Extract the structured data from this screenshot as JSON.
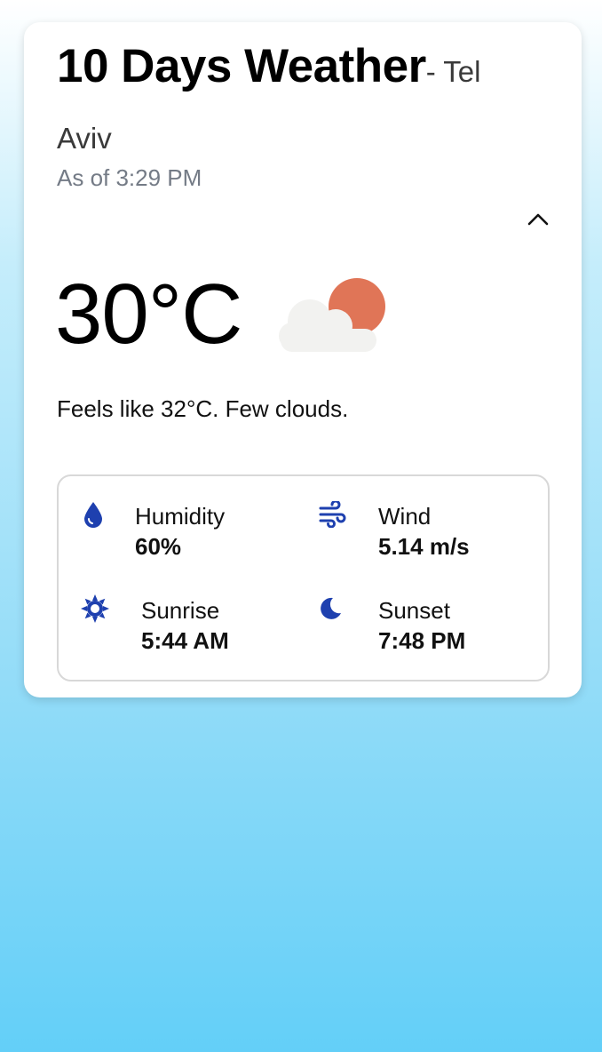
{
  "header": {
    "title": "10 Days Weather",
    "city": "- Tel Aviv",
    "as_of": "As of 3:29 PM"
  },
  "current": {
    "temperature": "30°C",
    "condition_icon": "few-clouds-icon",
    "description": "Feels like 32°C. Few clouds."
  },
  "details": {
    "humidity": {
      "label": "Humidity",
      "value": "60%",
      "icon": "water-drop-icon"
    },
    "wind": {
      "label": "Wind",
      "value": "5.14 m/s",
      "icon": "wind-icon"
    },
    "sunrise": {
      "label": "Sunrise",
      "value": "5:44 AM",
      "icon": "sun-icon"
    },
    "sunset": {
      "label": "Sunset",
      "value": "7:48 PM",
      "icon": "moon-icon"
    }
  },
  "colors": {
    "accent_icon": "#1e40af",
    "sun": "#e07557",
    "cloud": "#f2f2f0"
  }
}
